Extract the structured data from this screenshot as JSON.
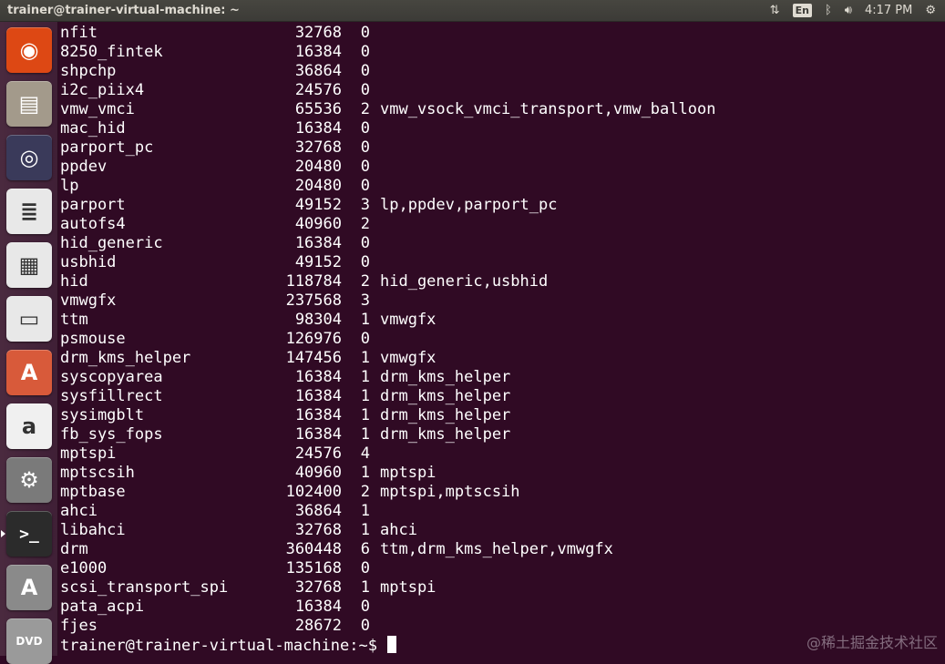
{
  "window_title": "trainer@trainer-virtual-machine: ~",
  "indicators": {
    "network_icon": "updown-arrows-icon",
    "keyboard_layout": "En",
    "bluetooth_icon": "bluetooth-icon",
    "volume_icon": "volume-icon",
    "time": "4:17 PM",
    "power_icon": "gear-power-icon"
  },
  "launcher": [
    {
      "name": "ubuntu-dash-icon",
      "glyph": "◉",
      "color": "#dd4814"
    },
    {
      "name": "files-icon",
      "glyph": "▤",
      "color": "#a39a8b"
    },
    {
      "name": "firefox-icon",
      "glyph": "◎",
      "color": "#3a3a5a"
    },
    {
      "name": "writer-icon",
      "glyph": "≣",
      "color": "#e8e8e8"
    },
    {
      "name": "calc-icon",
      "glyph": "▦",
      "color": "#e8e8e8"
    },
    {
      "name": "impress-icon",
      "glyph": "▭",
      "color": "#e8e8e8"
    },
    {
      "name": "software-center-icon",
      "glyph": "A",
      "color": "#d85a3a"
    },
    {
      "name": "amazon-icon",
      "glyph": "a",
      "color": "#f0f0f0"
    },
    {
      "name": "system-settings-icon",
      "glyph": "⚙",
      "color": "#7a7a7a"
    },
    {
      "name": "terminal-icon",
      "glyph": ">_",
      "color": "#2b2b2b",
      "active": true
    },
    {
      "name": "software-updater-icon",
      "glyph": "A",
      "color": "#8a8a8a"
    },
    {
      "name": "dvd-icon",
      "glyph": "DVD",
      "color": "#9a9a9a"
    }
  ],
  "modules": [
    {
      "module": "nfit",
      "size": "32768",
      "used": "0",
      "by": ""
    },
    {
      "module": "8250_fintek",
      "size": "16384",
      "used": "0",
      "by": ""
    },
    {
      "module": "shpchp",
      "size": "36864",
      "used": "0",
      "by": ""
    },
    {
      "module": "i2c_piix4",
      "size": "24576",
      "used": "0",
      "by": ""
    },
    {
      "module": "vmw_vmci",
      "size": "65536",
      "used": "2",
      "by": "vmw_vsock_vmci_transport,vmw_balloon"
    },
    {
      "module": "mac_hid",
      "size": "16384",
      "used": "0",
      "by": ""
    },
    {
      "module": "parport_pc",
      "size": "32768",
      "used": "0",
      "by": ""
    },
    {
      "module": "ppdev",
      "size": "20480",
      "used": "0",
      "by": ""
    },
    {
      "module": "lp",
      "size": "20480",
      "used": "0",
      "by": ""
    },
    {
      "module": "parport",
      "size": "49152",
      "used": "3",
      "by": "lp,ppdev,parport_pc"
    },
    {
      "module": "autofs4",
      "size": "40960",
      "used": "2",
      "by": ""
    },
    {
      "module": "hid_generic",
      "size": "16384",
      "used": "0",
      "by": ""
    },
    {
      "module": "usbhid",
      "size": "49152",
      "used": "0",
      "by": ""
    },
    {
      "module": "hid",
      "size": "118784",
      "used": "2",
      "by": "hid_generic,usbhid"
    },
    {
      "module": "vmwgfx",
      "size": "237568",
      "used": "3",
      "by": ""
    },
    {
      "module": "ttm",
      "size": "98304",
      "used": "1",
      "by": "vmwgfx"
    },
    {
      "module": "psmouse",
      "size": "126976",
      "used": "0",
      "by": ""
    },
    {
      "module": "drm_kms_helper",
      "size": "147456",
      "used": "1",
      "by": "vmwgfx"
    },
    {
      "module": "syscopyarea",
      "size": "16384",
      "used": "1",
      "by": "drm_kms_helper"
    },
    {
      "module": "sysfillrect",
      "size": "16384",
      "used": "1",
      "by": "drm_kms_helper"
    },
    {
      "module": "sysimgblt",
      "size": "16384",
      "used": "1",
      "by": "drm_kms_helper"
    },
    {
      "module": "fb_sys_fops",
      "size": "16384",
      "used": "1",
      "by": "drm_kms_helper"
    },
    {
      "module": "mptspi",
      "size": "24576",
      "used": "4",
      "by": ""
    },
    {
      "module": "mptscsih",
      "size": "40960",
      "used": "1",
      "by": "mptspi"
    },
    {
      "module": "mptbase",
      "size": "102400",
      "used": "2",
      "by": "mptspi,mptscsih"
    },
    {
      "module": "ahci",
      "size": "36864",
      "used": "1",
      "by": ""
    },
    {
      "module": "libahci",
      "size": "32768",
      "used": "1",
      "by": "ahci"
    },
    {
      "module": "drm",
      "size": "360448",
      "used": "6",
      "by": "ttm,drm_kms_helper,vmwgfx"
    },
    {
      "module": "e1000",
      "size": "135168",
      "used": "0",
      "by": ""
    },
    {
      "module": "scsi_transport_spi",
      "size": "32768",
      "used": "1",
      "by": "mptspi"
    },
    {
      "module": "pata_acpi",
      "size": "16384",
      "used": "0",
      "by": ""
    },
    {
      "module": "fjes",
      "size": "28672",
      "used": "0",
      "by": ""
    }
  ],
  "prompt": "trainer@trainer-virtual-machine:~$",
  "watermark": "@稀土掘金技术社区",
  "colors": {
    "terminal_bg": "#300a24",
    "terminal_fg": "#ffffff",
    "panel_bg": "#3c3b37"
  }
}
